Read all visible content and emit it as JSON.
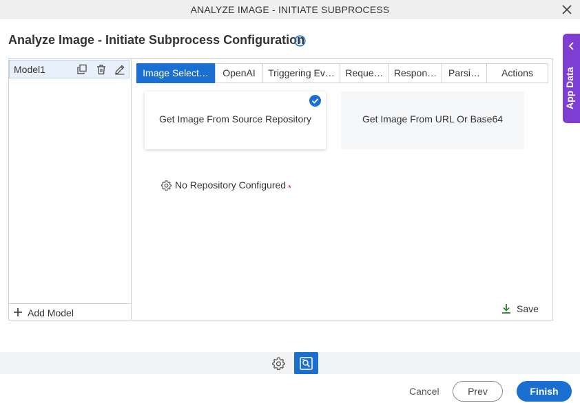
{
  "window": {
    "title": "ANALYZE IMAGE - INITIATE SUBPROCESS",
    "close_icon": "close-icon"
  },
  "page": {
    "title": "Analyze Image - Initiate Subprocess Configuration",
    "info_icon": "info-icon"
  },
  "app_data_tab": {
    "label": "App Data",
    "accent": "#7e3ed3"
  },
  "models": {
    "items": [
      {
        "name": "Model1"
      }
    ],
    "add_label": "Add Model"
  },
  "tabs": [
    {
      "label": "Image Select…",
      "active": true
    },
    {
      "label": "OpenAI"
    },
    {
      "label": "Triggering Ev…"
    },
    {
      "label": "Reque…"
    },
    {
      "label": "Respon…"
    },
    {
      "label": "Parsi…"
    },
    {
      "label": "Actions"
    }
  ],
  "image_source": {
    "options": [
      {
        "label": "Get Image From Source Repository",
        "selected": true
      },
      {
        "label": "Get Image From URL Or Base64",
        "selected": false
      }
    ]
  },
  "repository": {
    "label": "No Repository Configured",
    "required_mark": "*"
  },
  "save_label": "Save",
  "footer": {
    "cancel": "Cancel",
    "prev": "Prev",
    "finish": "Finish"
  },
  "colors": {
    "primary": "#1b6fd1",
    "accent": "#7e3ed3",
    "required": "#d0312d"
  }
}
